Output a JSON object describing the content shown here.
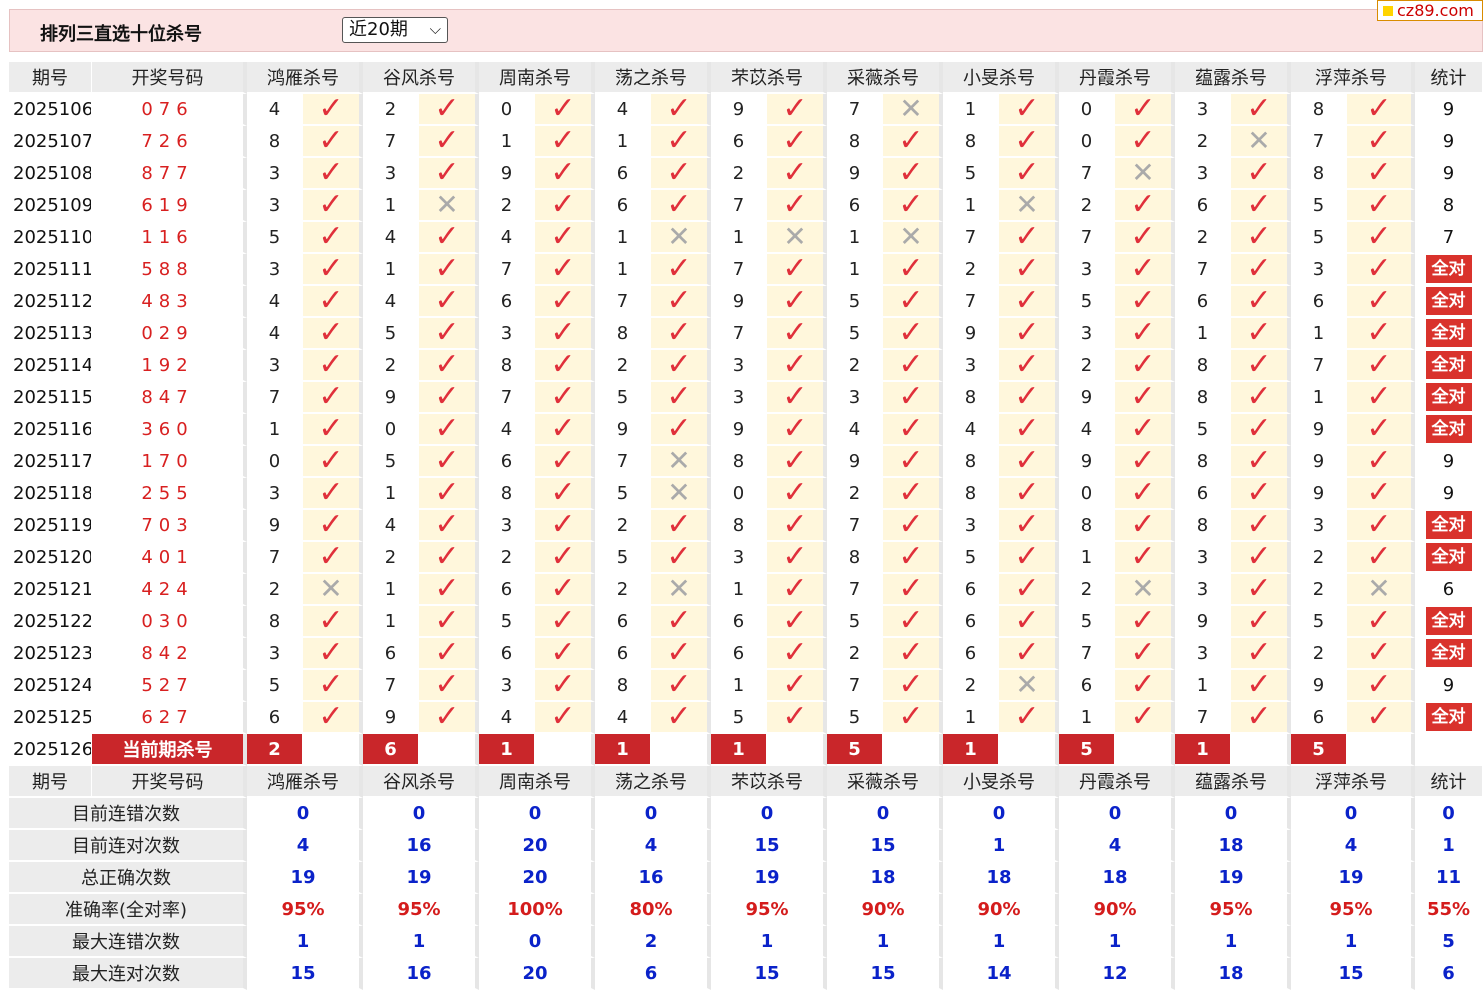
{
  "title": "排列三直选十位杀号",
  "period_select": {
    "value": "近20期"
  },
  "logo": "cz89.com",
  "headers": [
    "期号",
    "开奖号码",
    "鸿雁杀号",
    "谷风杀号",
    "周南杀号",
    "荡之杀号",
    "芣苡杀号",
    "采薇杀号",
    "小旻杀号",
    "丹霞杀号",
    "蕴露杀号",
    "浮萍杀号",
    "统计"
  ],
  "rows": [
    {
      "period": "2025106",
      "draw": "076",
      "kills": [
        [
          "4",
          "ok"
        ],
        [
          "2",
          "ok"
        ],
        [
          "0",
          "ok"
        ],
        [
          "4",
          "ok"
        ],
        [
          "9",
          "ok"
        ],
        [
          "7",
          "x"
        ],
        [
          "1",
          "ok"
        ],
        [
          "0",
          "ok"
        ],
        [
          "3",
          "ok"
        ],
        [
          "8",
          "ok"
        ]
      ],
      "stat": "9"
    },
    {
      "period": "2025107",
      "draw": "726",
      "kills": [
        [
          "8",
          "ok"
        ],
        [
          "7",
          "ok"
        ],
        [
          "1",
          "ok"
        ],
        [
          "1",
          "ok"
        ],
        [
          "6",
          "ok"
        ],
        [
          "8",
          "ok"
        ],
        [
          "8",
          "ok"
        ],
        [
          "0",
          "ok"
        ],
        [
          "2",
          "x"
        ],
        [
          "7",
          "ok"
        ]
      ],
      "stat": "9"
    },
    {
      "period": "2025108",
      "draw": "877",
      "kills": [
        [
          "3",
          "ok"
        ],
        [
          "3",
          "ok"
        ],
        [
          "9",
          "ok"
        ],
        [
          "6",
          "ok"
        ],
        [
          "2",
          "ok"
        ],
        [
          "9",
          "ok"
        ],
        [
          "5",
          "ok"
        ],
        [
          "7",
          "x"
        ],
        [
          "3",
          "ok"
        ],
        [
          "8",
          "ok"
        ]
      ],
      "stat": "9"
    },
    {
      "period": "2025109",
      "draw": "619",
      "kills": [
        [
          "3",
          "ok"
        ],
        [
          "1",
          "x"
        ],
        [
          "2",
          "ok"
        ],
        [
          "6",
          "ok"
        ],
        [
          "7",
          "ok"
        ],
        [
          "6",
          "ok"
        ],
        [
          "1",
          "x"
        ],
        [
          "2",
          "ok"
        ],
        [
          "6",
          "ok"
        ],
        [
          "5",
          "ok"
        ]
      ],
      "stat": "8"
    },
    {
      "period": "2025110",
      "draw": "116",
      "kills": [
        [
          "5",
          "ok"
        ],
        [
          "4",
          "ok"
        ],
        [
          "4",
          "ok"
        ],
        [
          "1",
          "x"
        ],
        [
          "1",
          "x"
        ],
        [
          "1",
          "x"
        ],
        [
          "7",
          "ok"
        ],
        [
          "7",
          "ok"
        ],
        [
          "2",
          "ok"
        ],
        [
          "5",
          "ok"
        ]
      ],
      "stat": "7"
    },
    {
      "period": "2025111",
      "draw": "588",
      "kills": [
        [
          "3",
          "ok"
        ],
        [
          "1",
          "ok"
        ],
        [
          "7",
          "ok"
        ],
        [
          "1",
          "ok"
        ],
        [
          "7",
          "ok"
        ],
        [
          "1",
          "ok"
        ],
        [
          "2",
          "ok"
        ],
        [
          "3",
          "ok"
        ],
        [
          "7",
          "ok"
        ],
        [
          "3",
          "ok"
        ]
      ],
      "stat": "全对"
    },
    {
      "period": "2025112",
      "draw": "483",
      "kills": [
        [
          "4",
          "ok"
        ],
        [
          "4",
          "ok"
        ],
        [
          "6",
          "ok"
        ],
        [
          "7",
          "ok"
        ],
        [
          "9",
          "ok"
        ],
        [
          "5",
          "ok"
        ],
        [
          "7",
          "ok"
        ],
        [
          "5",
          "ok"
        ],
        [
          "6",
          "ok"
        ],
        [
          "6",
          "ok"
        ]
      ],
      "stat": "全对"
    },
    {
      "period": "2025113",
      "draw": "029",
      "kills": [
        [
          "4",
          "ok"
        ],
        [
          "5",
          "ok"
        ],
        [
          "3",
          "ok"
        ],
        [
          "8",
          "ok"
        ],
        [
          "7",
          "ok"
        ],
        [
          "5",
          "ok"
        ],
        [
          "9",
          "ok"
        ],
        [
          "3",
          "ok"
        ],
        [
          "1",
          "ok"
        ],
        [
          "1",
          "ok"
        ]
      ],
      "stat": "全对"
    },
    {
      "period": "2025114",
      "draw": "192",
      "kills": [
        [
          "3",
          "ok"
        ],
        [
          "2",
          "ok"
        ],
        [
          "8",
          "ok"
        ],
        [
          "2",
          "ok"
        ],
        [
          "3",
          "ok"
        ],
        [
          "2",
          "ok"
        ],
        [
          "3",
          "ok"
        ],
        [
          "2",
          "ok"
        ],
        [
          "8",
          "ok"
        ],
        [
          "7",
          "ok"
        ]
      ],
      "stat": "全对"
    },
    {
      "period": "2025115",
      "draw": "847",
      "kills": [
        [
          "7",
          "ok"
        ],
        [
          "9",
          "ok"
        ],
        [
          "7",
          "ok"
        ],
        [
          "5",
          "ok"
        ],
        [
          "3",
          "ok"
        ],
        [
          "3",
          "ok"
        ],
        [
          "8",
          "ok"
        ],
        [
          "9",
          "ok"
        ],
        [
          "8",
          "ok"
        ],
        [
          "1",
          "ok"
        ]
      ],
      "stat": "全对"
    },
    {
      "period": "2025116",
      "draw": "360",
      "kills": [
        [
          "1",
          "ok"
        ],
        [
          "0",
          "ok"
        ],
        [
          "4",
          "ok"
        ],
        [
          "9",
          "ok"
        ],
        [
          "9",
          "ok"
        ],
        [
          "4",
          "ok"
        ],
        [
          "4",
          "ok"
        ],
        [
          "4",
          "ok"
        ],
        [
          "5",
          "ok"
        ],
        [
          "9",
          "ok"
        ]
      ],
      "stat": "全对"
    },
    {
      "period": "2025117",
      "draw": "170",
      "kills": [
        [
          "0",
          "ok"
        ],
        [
          "5",
          "ok"
        ],
        [
          "6",
          "ok"
        ],
        [
          "7",
          "x"
        ],
        [
          "8",
          "ok"
        ],
        [
          "9",
          "ok"
        ],
        [
          "8",
          "ok"
        ],
        [
          "9",
          "ok"
        ],
        [
          "8",
          "ok"
        ],
        [
          "9",
          "ok"
        ]
      ],
      "stat": "9"
    },
    {
      "period": "2025118",
      "draw": "255",
      "kills": [
        [
          "3",
          "ok"
        ],
        [
          "1",
          "ok"
        ],
        [
          "8",
          "ok"
        ],
        [
          "5",
          "x"
        ],
        [
          "0",
          "ok"
        ],
        [
          "2",
          "ok"
        ],
        [
          "8",
          "ok"
        ],
        [
          "0",
          "ok"
        ],
        [
          "6",
          "ok"
        ],
        [
          "9",
          "ok"
        ]
      ],
      "stat": "9"
    },
    {
      "period": "2025119",
      "draw": "703",
      "kills": [
        [
          "9",
          "ok"
        ],
        [
          "4",
          "ok"
        ],
        [
          "3",
          "ok"
        ],
        [
          "2",
          "ok"
        ],
        [
          "8",
          "ok"
        ],
        [
          "7",
          "ok"
        ],
        [
          "3",
          "ok"
        ],
        [
          "8",
          "ok"
        ],
        [
          "8",
          "ok"
        ],
        [
          "3",
          "ok"
        ]
      ],
      "stat": "全对"
    },
    {
      "period": "2025120",
      "draw": "401",
      "kills": [
        [
          "7",
          "ok"
        ],
        [
          "2",
          "ok"
        ],
        [
          "2",
          "ok"
        ],
        [
          "5",
          "ok"
        ],
        [
          "3",
          "ok"
        ],
        [
          "8",
          "ok"
        ],
        [
          "5",
          "ok"
        ],
        [
          "1",
          "ok"
        ],
        [
          "3",
          "ok"
        ],
        [
          "2",
          "ok"
        ]
      ],
      "stat": "全对"
    },
    {
      "period": "2025121",
      "draw": "424",
      "kills": [
        [
          "2",
          "x"
        ],
        [
          "1",
          "ok"
        ],
        [
          "6",
          "ok"
        ],
        [
          "2",
          "x"
        ],
        [
          "1",
          "ok"
        ],
        [
          "7",
          "ok"
        ],
        [
          "6",
          "ok"
        ],
        [
          "2",
          "x"
        ],
        [
          "3",
          "ok"
        ],
        [
          "2",
          "x"
        ]
      ],
      "stat": "6"
    },
    {
      "period": "2025122",
      "draw": "030",
      "kills": [
        [
          "8",
          "ok"
        ],
        [
          "1",
          "ok"
        ],
        [
          "5",
          "ok"
        ],
        [
          "6",
          "ok"
        ],
        [
          "6",
          "ok"
        ],
        [
          "5",
          "ok"
        ],
        [
          "6",
          "ok"
        ],
        [
          "5",
          "ok"
        ],
        [
          "9",
          "ok"
        ],
        [
          "5",
          "ok"
        ]
      ],
      "stat": "全对"
    },
    {
      "period": "2025123",
      "draw": "842",
      "kills": [
        [
          "3",
          "ok"
        ],
        [
          "6",
          "ok"
        ],
        [
          "6",
          "ok"
        ],
        [
          "6",
          "ok"
        ],
        [
          "6",
          "ok"
        ],
        [
          "2",
          "ok"
        ],
        [
          "6",
          "ok"
        ],
        [
          "7",
          "ok"
        ],
        [
          "3",
          "ok"
        ],
        [
          "2",
          "ok"
        ]
      ],
      "stat": "全对"
    },
    {
      "period": "2025124",
      "draw": "527",
      "kills": [
        [
          "5",
          "ok"
        ],
        [
          "7",
          "ok"
        ],
        [
          "3",
          "ok"
        ],
        [
          "8",
          "ok"
        ],
        [
          "1",
          "ok"
        ],
        [
          "7",
          "ok"
        ],
        [
          "2",
          "x"
        ],
        [
          "6",
          "ok"
        ],
        [
          "1",
          "ok"
        ],
        [
          "9",
          "ok"
        ]
      ],
      "stat": "9"
    },
    {
      "period": "2025125",
      "draw": "627",
      "kills": [
        [
          "6",
          "ok"
        ],
        [
          "9",
          "ok"
        ],
        [
          "4",
          "ok"
        ],
        [
          "4",
          "ok"
        ],
        [
          "5",
          "ok"
        ],
        [
          "5",
          "ok"
        ],
        [
          "1",
          "ok"
        ],
        [
          "1",
          "ok"
        ],
        [
          "7",
          "ok"
        ],
        [
          "6",
          "ok"
        ]
      ],
      "stat": "全对"
    }
  ],
  "current": {
    "period": "2025126",
    "label": "当前期杀号",
    "kills": [
      "2",
      "6",
      "1",
      "1",
      "1",
      "5",
      "1",
      "5",
      "1",
      "5"
    ]
  },
  "summary": [
    {
      "label": "目前连错次数",
      "type": "num",
      "values": [
        "0",
        "0",
        "0",
        "0",
        "0",
        "0",
        "0",
        "0",
        "0",
        "0",
        "0"
      ]
    },
    {
      "label": "目前连对次数",
      "type": "num",
      "values": [
        "4",
        "16",
        "20",
        "4",
        "15",
        "15",
        "1",
        "4",
        "18",
        "4",
        "1"
      ]
    },
    {
      "label": "总正确次数",
      "type": "num",
      "values": [
        "19",
        "19",
        "20",
        "16",
        "19",
        "18",
        "18",
        "18",
        "19",
        "19",
        "11"
      ]
    },
    {
      "label": "准确率(全对率)",
      "type": "pct",
      "values": [
        "95%",
        "95%",
        "100%",
        "80%",
        "95%",
        "90%",
        "90%",
        "90%",
        "95%",
        "95%",
        "55%"
      ]
    },
    {
      "label": "最大连错次数",
      "type": "num",
      "values": [
        "1",
        "1",
        "0",
        "2",
        "1",
        "1",
        "1",
        "1",
        "1",
        "1",
        "5"
      ]
    },
    {
      "label": "最大连对次数",
      "type": "num",
      "values": [
        "15",
        "16",
        "20",
        "6",
        "15",
        "15",
        "14",
        "12",
        "18",
        "15",
        "6"
      ]
    }
  ],
  "icons": {
    "correct": "check-icon",
    "wrong": "cross-icon"
  },
  "colors": {
    "check": "#e0303b",
    "cross": "#aaaaaa",
    "allok_bg": "#d9322c",
    "stat_value": "#0a22c9",
    "pct_value": "#d41c1c",
    "header_bg": "#fbe3e3"
  }
}
